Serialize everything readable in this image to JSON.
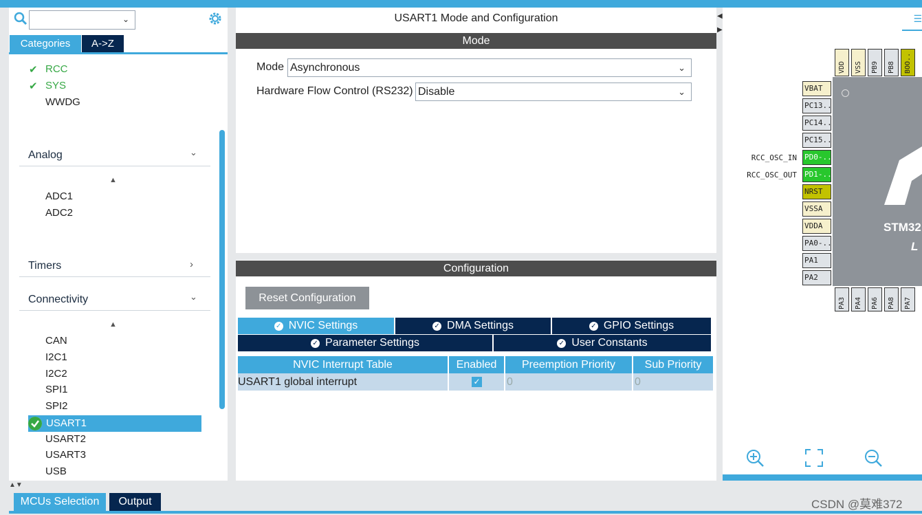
{
  "colors": {
    "accent": "#3fa9dc",
    "dark": "#06264f",
    "ok_green": "#36a845",
    "pin_green": "#28c72d",
    "pin_olive": "#c2c200"
  },
  "left_panel": {
    "tab_categories": "Categories",
    "tab_az": "A->Z",
    "system_items": [
      {
        "label": "RCC",
        "checked": true
      },
      {
        "label": "SYS",
        "checked": true
      },
      {
        "label": "WWDG",
        "checked": false
      }
    ],
    "groups": {
      "analog": "Analog",
      "timers": "Timers",
      "connectivity": "Connectivity"
    },
    "analog_items": [
      "ADC1",
      "ADC2"
    ],
    "connectivity_items": [
      "CAN",
      "I2C1",
      "I2C2",
      "SPI1",
      "SPI2",
      "USART1",
      "USART2",
      "USART3",
      "USB"
    ],
    "selected": "USART1"
  },
  "mode_panel": {
    "title": "USART1 Mode and Configuration",
    "mode_header": "Mode",
    "mode_label": "Mode",
    "mode_value": "Asynchronous",
    "flow_label": "Hardware Flow Control (RS232)",
    "flow_value": "Disable"
  },
  "config_panel": {
    "header": "Configuration",
    "reset_button": "Reset Configuration",
    "tabs": [
      "NVIC Settings",
      "DMA Settings",
      "GPIO Settings",
      "Parameter Settings",
      "User Constants"
    ],
    "active_tab": "NVIC Settings",
    "table": {
      "columns": [
        "NVIC Interrupt Table",
        "Enabled",
        "Preemption Priority",
        "Sub Priority"
      ],
      "rows": [
        {
          "name": "USART1 global interrupt",
          "enabled": true,
          "preemption": "0",
          "sub": "0"
        }
      ]
    }
  },
  "pinout": {
    "left_pins": [
      "VBAT",
      "PC13..",
      "PC14..",
      "PC15..",
      "PD0-..",
      "PD1-..",
      "NRST",
      "VSSA",
      "VDDA",
      "PA0-..",
      "PA1",
      "PA2"
    ],
    "top_pins": [
      "VDD",
      "VSS",
      "PB9",
      "PB8",
      "BOO.."
    ],
    "bottom_pins": [
      "PA3",
      "PA4",
      "PA6",
      "PA8",
      "PA7"
    ],
    "signals": {
      "osc_in": "RCC_OSC_IN",
      "osc_out": "RCC_OSC_OUT"
    },
    "chip_text": "STM32",
    "chip_sub": "L"
  },
  "bottom": {
    "mcus_selection": "MCUs Selection",
    "output": "Output",
    "watermark": "CSDN @莫难372"
  }
}
